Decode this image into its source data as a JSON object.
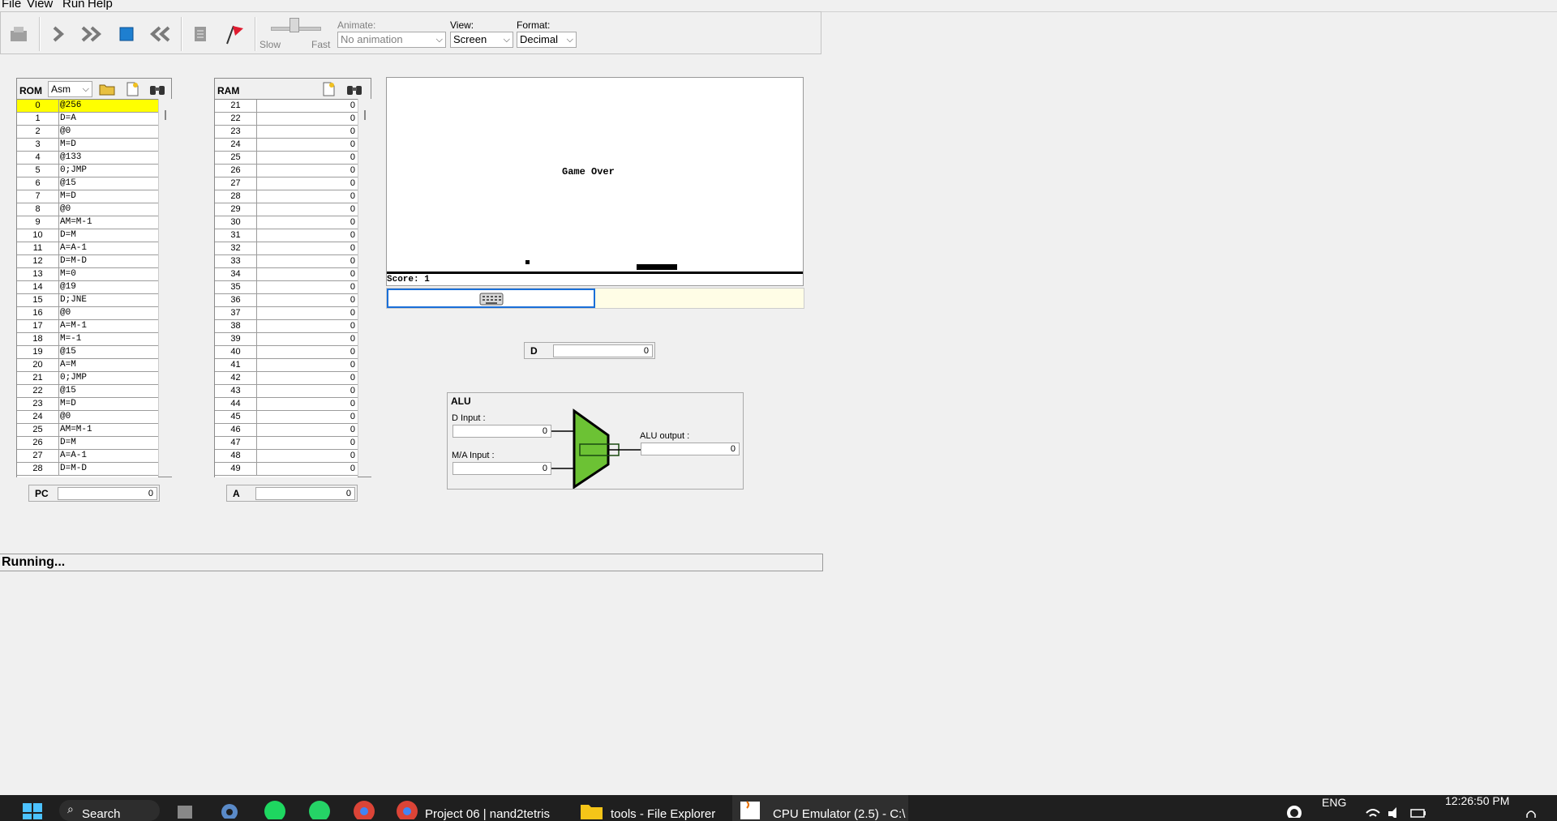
{
  "menu": [
    "File",
    "View",
    "Run",
    "Help"
  ],
  "toolbar": {
    "speed_slow": "Slow",
    "speed_fast": "Fast",
    "animate_label": "Animate:",
    "animate_value": "No animation",
    "view_label": "View:",
    "view_value": "Screen",
    "format_label": "Format:",
    "format_value": "Decimal"
  },
  "rom": {
    "title": "ROM",
    "mode": "Asm",
    "rows": [
      {
        "addr": "0",
        "val": "@256"
      },
      {
        "addr": "1",
        "val": "D=A"
      },
      {
        "addr": "2",
        "val": "@0"
      },
      {
        "addr": "3",
        "val": "M=D"
      },
      {
        "addr": "4",
        "val": "@133"
      },
      {
        "addr": "5",
        "val": "0;JMP"
      },
      {
        "addr": "6",
        "val": "@15"
      },
      {
        "addr": "7",
        "val": "M=D"
      },
      {
        "addr": "8",
        "val": "@0"
      },
      {
        "addr": "9",
        "val": "AM=M-1"
      },
      {
        "addr": "10",
        "val": "D=M"
      },
      {
        "addr": "11",
        "val": "A=A-1"
      },
      {
        "addr": "12",
        "val": "D=M-D"
      },
      {
        "addr": "13",
        "val": "M=0"
      },
      {
        "addr": "14",
        "val": "@19"
      },
      {
        "addr": "15",
        "val": "D;JNE"
      },
      {
        "addr": "16",
        "val": "@0"
      },
      {
        "addr": "17",
        "val": "A=M-1"
      },
      {
        "addr": "18",
        "val": "M=-1"
      },
      {
        "addr": "19",
        "val": "@15"
      },
      {
        "addr": "20",
        "val": "A=M"
      },
      {
        "addr": "21",
        "val": "0;JMP"
      },
      {
        "addr": "22",
        "val": "@15"
      },
      {
        "addr": "23",
        "val": "M=D"
      },
      {
        "addr": "24",
        "val": "@0"
      },
      {
        "addr": "25",
        "val": "AM=M-1"
      },
      {
        "addr": "26",
        "val": "D=M"
      },
      {
        "addr": "27",
        "val": "A=A-1"
      },
      {
        "addr": "28",
        "val": "D=M-D"
      }
    ]
  },
  "ram": {
    "title": "RAM",
    "rows": [
      {
        "addr": "21",
        "val": "0"
      },
      {
        "addr": "22",
        "val": "0"
      },
      {
        "addr": "23",
        "val": "0"
      },
      {
        "addr": "24",
        "val": "0"
      },
      {
        "addr": "25",
        "val": "0"
      },
      {
        "addr": "26",
        "val": "0"
      },
      {
        "addr": "27",
        "val": "0"
      },
      {
        "addr": "28",
        "val": "0"
      },
      {
        "addr": "29",
        "val": "0"
      },
      {
        "addr": "30",
        "val": "0"
      },
      {
        "addr": "31",
        "val": "0"
      },
      {
        "addr": "32",
        "val": "0"
      },
      {
        "addr": "33",
        "val": "0"
      },
      {
        "addr": "34",
        "val": "0"
      },
      {
        "addr": "35",
        "val": "0"
      },
      {
        "addr": "36",
        "val": "0"
      },
      {
        "addr": "37",
        "val": "0"
      },
      {
        "addr": "38",
        "val": "0"
      },
      {
        "addr": "39",
        "val": "0"
      },
      {
        "addr": "40",
        "val": "0"
      },
      {
        "addr": "41",
        "val": "0"
      },
      {
        "addr": "42",
        "val": "0"
      },
      {
        "addr": "43",
        "val": "0"
      },
      {
        "addr": "44",
        "val": "0"
      },
      {
        "addr": "45",
        "val": "0"
      },
      {
        "addr": "46",
        "val": "0"
      },
      {
        "addr": "47",
        "val": "0"
      },
      {
        "addr": "48",
        "val": "0"
      },
      {
        "addr": "49",
        "val": "0"
      }
    ]
  },
  "registers": {
    "pc_label": "PC",
    "pc_value": "0",
    "a_label": "A",
    "a_value": "0",
    "d_label": "D",
    "d_value": "0"
  },
  "screen": {
    "game_over": "Game Over",
    "score": "Score: 1"
  },
  "alu": {
    "title": "ALU",
    "d_input_label": "D Input :",
    "d_input_value": "0",
    "ma_input_label": "M/A Input :",
    "ma_input_value": "0",
    "output_label": "ALU output :",
    "output_value": "0",
    "fill_color": "#6cc234"
  },
  "status": "Running...",
  "taskbar": {
    "search": "Search",
    "app1": "Project 06 | nand2tetris",
    "app2": "tools - File Explorer",
    "app3": "CPU Emulator (2.5) - C:\\",
    "lang": "ENG",
    "time": "12:26:50 PM"
  }
}
